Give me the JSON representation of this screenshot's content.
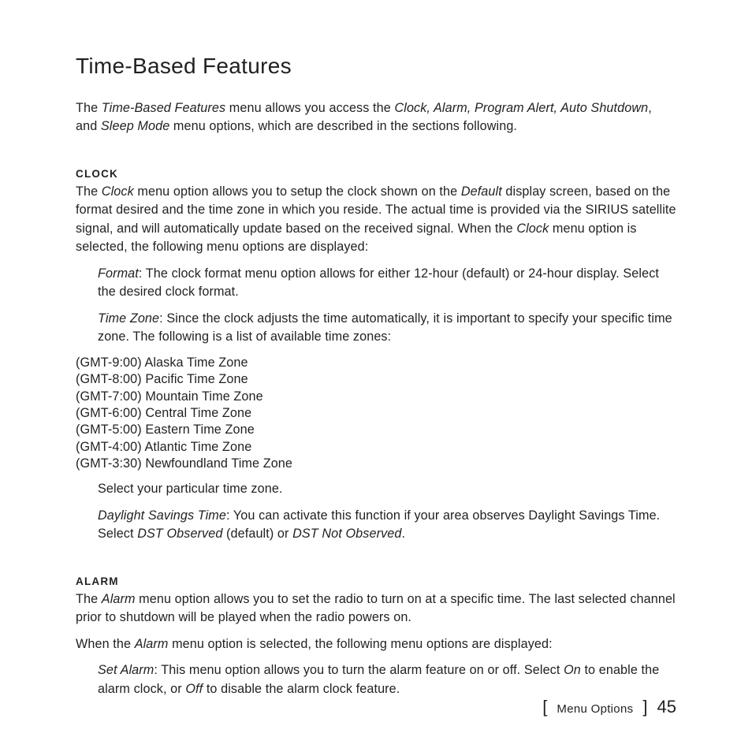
{
  "title": "Time-Based Features",
  "intro": {
    "pre": "The ",
    "em1": "Time-Based Features",
    "mid1": " menu allows you access the ",
    "em2": "Clock, Alarm, Program Alert, Auto Shutdown",
    "mid2": ", and ",
    "em3": "Sleep Mode",
    "post": " menu options, which are described in the sections following."
  },
  "clock": {
    "heading": "CLOCK",
    "p1": {
      "pre": "The ",
      "em1": "Clock",
      "mid1": " menu option allows you to setup the clock shown on the ",
      "em2": "Default",
      "mid2": " display screen, based on the format desired and the time zone in which you reside. The actual time is provid­ed via the SIRIUS satellite signal, and will automatically update based on the received signal. When the ",
      "em3": "Clock",
      "post": " menu option is selected, the following menu options are displayed:"
    },
    "format": {
      "em": "Format",
      "text": ": The clock format menu option allows for either 12-hour (default) or 24-hour dis­play. Select the desired clock format."
    },
    "timezone": {
      "em": "Time Zone",
      "text": ": Since the clock adjusts the time automatically, it is important to specify your specific time zone. The following is a list of available time zones:"
    },
    "timezones": [
      "(GMT-9:00) Alaska Time Zone",
      "(GMT-8:00) Pacific Time Zone",
      "(GMT-7:00) Mountain Time Zone",
      "(GMT-6:00) Central Time Zone",
      "(GMT-5:00) Eastern Time Zone",
      "(GMT-4:00) Atlantic Time Zone",
      "(GMT-3:30) Newfoundland Time Zone"
    ],
    "select_tz": "Select your particular time zone.",
    "dst": {
      "em1": "Daylight Savings Time",
      "mid1": ": You can activate this function if your area observes Daylight Sav­ings Time. Select ",
      "em2": "DST Observed",
      "mid2": " (default) or ",
      "em3": "DST Not Observed",
      "post": "."
    }
  },
  "alarm": {
    "heading": "ALARM",
    "p1": {
      "pre": "The ",
      "em1": "Alarm",
      "post": " menu option allows you to set the radio to turn on at a specific time. The last selected channel prior to shutdown will be played when the radio powers on."
    },
    "p2": {
      "pre": "When the ",
      "em1": "Alarm",
      "post": " menu option is selected, the following menu options are displayed:"
    },
    "setalarm": {
      "em1": "Set Alarm",
      "mid1": ": This menu option allows you to turn the alarm feature on or off. Select ",
      "em2": "On",
      "mid2": " to enable the alarm clock, or ",
      "em3": "Off",
      "post": " to disable the alarm clock feature."
    }
  },
  "footer": {
    "section": "Menu Options",
    "page": "45"
  }
}
